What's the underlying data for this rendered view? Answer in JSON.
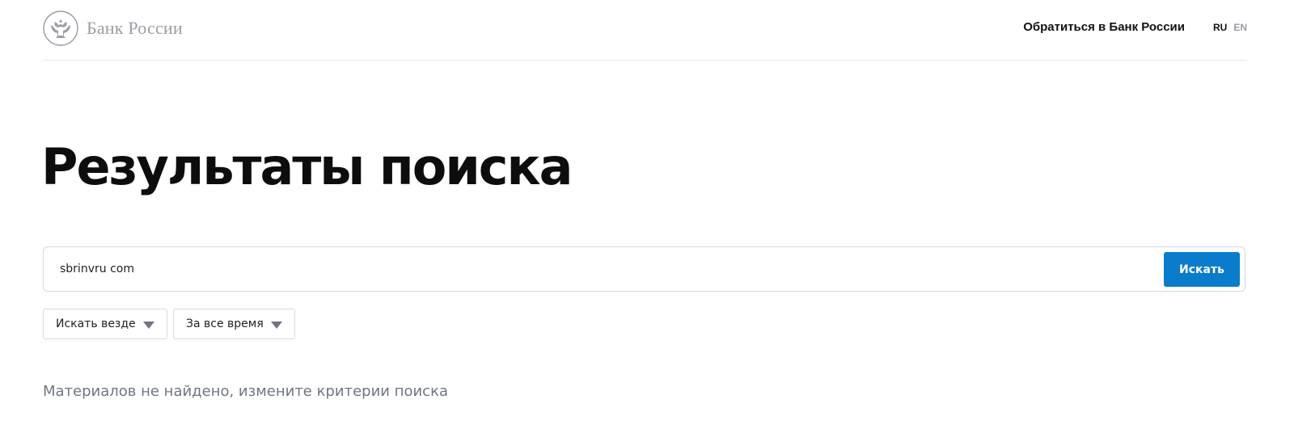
{
  "header": {
    "logo_text": "Банк России",
    "contact_link": "Обратиться в Банк России",
    "languages": {
      "ru": "RU",
      "en": "EN"
    }
  },
  "main": {
    "title": "Результаты поиска",
    "search": {
      "value": "sbrinvru com",
      "button_label": "Искать"
    },
    "filters": [
      {
        "label": "Искать везде",
        "icon": "chevron-down-icon"
      },
      {
        "label": "За все время",
        "icon": "chevron-down-icon"
      }
    ],
    "no_results_message": "Материалов не найдено, измените критерии поиска"
  },
  "colors": {
    "accent": "#0a7ccb",
    "muted_text": "#6f7680",
    "logo_gray": "#9a9ea5"
  }
}
